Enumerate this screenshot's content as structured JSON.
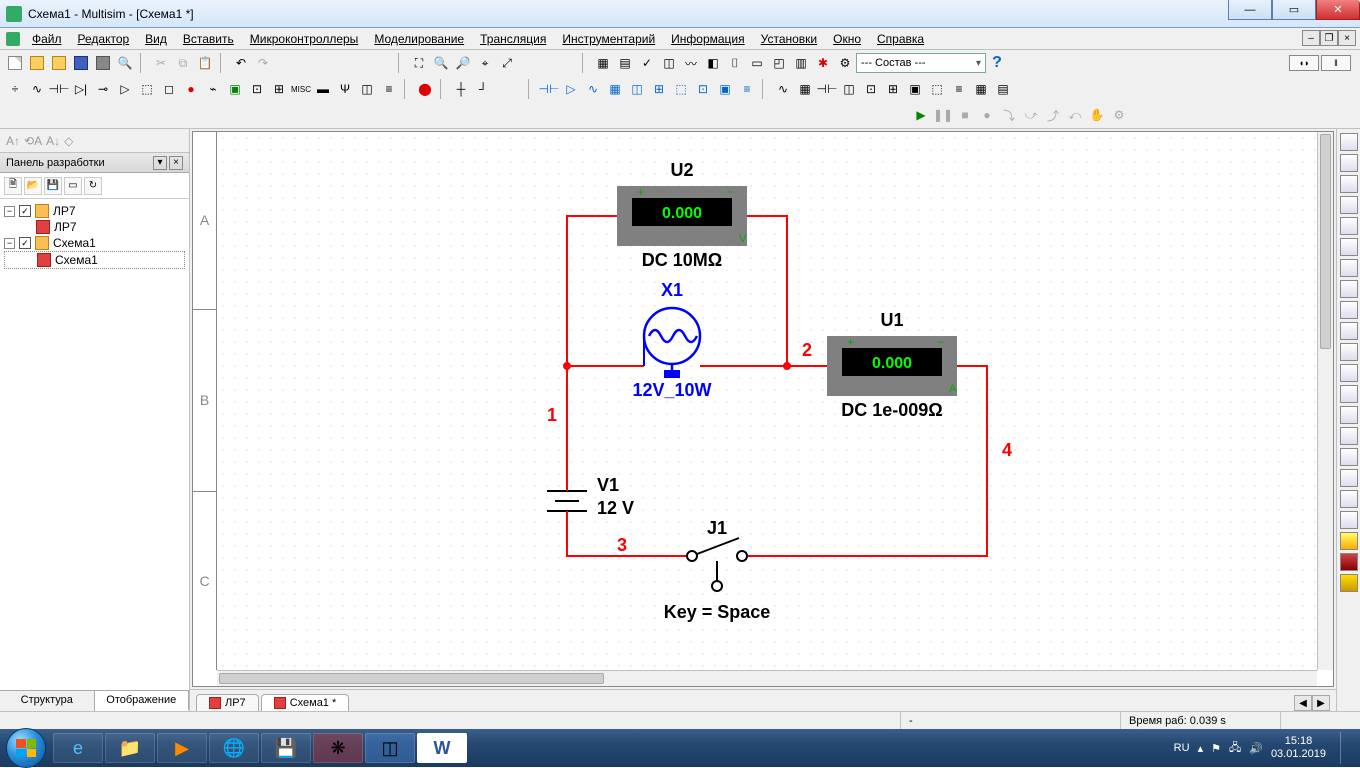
{
  "title": "Схема1 - Multisim - [Схема1 *]",
  "menu": [
    "Файл",
    "Редактор",
    "Вид",
    "Вставить",
    "Микроконтроллеры",
    "Моделирование",
    "Трансляция",
    "Инструментарий",
    "Информация",
    "Установки",
    "Окно",
    "Справка"
  ],
  "layer_select": "--- Состав ---",
  "sidebar": {
    "title": "Панель разработки",
    "nodes": {
      "p1": "ЛР7",
      "p1doc": "ЛР7",
      "p2": "Схема1",
      "p2doc": "Схема1"
    },
    "tabs": {
      "t1": "Структура",
      "t2": "Отображение"
    }
  },
  "doc_tabs": {
    "t1": "ЛР7",
    "t2": "Схема1 *"
  },
  "row_labels": [
    "A",
    "B",
    "C"
  ],
  "circuit": {
    "u2_name": "U2",
    "u2_val": "0.000",
    "u2_mode": "DC  10MΩ",
    "u1_name": "U1",
    "u1_val": "0.000",
    "u1_mode": "DC  1e-009Ω",
    "x1_name": "X1",
    "x1_rating": "12V_10W",
    "v1_name": "V1",
    "v1_val": "12 V",
    "j1_name": "J1",
    "j1_key": "Key = Space",
    "n1": "1",
    "n2": "2",
    "n3": "3",
    "n4": "4"
  },
  "status": {
    "coord": "-",
    "time": "Время раб: 0.039 s"
  },
  "taskbar": {
    "lang": "RU",
    "time": "15:18",
    "date": "03.01.2019"
  },
  "chart_data": {
    "type": "diagram",
    "description": "Electronic circuit schematic in Multisim",
    "components": [
      {
        "id": "V1",
        "type": "dc-voltage-source",
        "value_V": 12
      },
      {
        "id": "X1",
        "type": "lamp",
        "rating": "12V 10W"
      },
      {
        "id": "U2",
        "type": "voltmeter",
        "mode": "DC",
        "internal_resistance": "10 MΩ",
        "reading_V": 0.0,
        "across": "X1"
      },
      {
        "id": "U1",
        "type": "ammeter",
        "mode": "DC",
        "internal_resistance": "1e-009 Ω",
        "reading_A": 0.0,
        "in_series_with": "X1"
      },
      {
        "id": "J1",
        "type": "switch",
        "key": "Space",
        "state": "open"
      }
    ],
    "nets": [
      {
        "id": 1,
        "connects": [
          "V1+",
          "X1.a",
          "U2+"
        ]
      },
      {
        "id": 2,
        "connects": [
          "X1.b",
          "U2-",
          "U1+"
        ]
      },
      {
        "id": 3,
        "connects": [
          "V1-",
          "J1.a"
        ]
      },
      {
        "id": 4,
        "connects": [
          "U1-",
          "J1.b"
        ]
      }
    ],
    "topology": "V1 drives lamp X1 (with voltmeter U2 across it) in series with ammeter U1 and open switch J1 back to V1"
  }
}
